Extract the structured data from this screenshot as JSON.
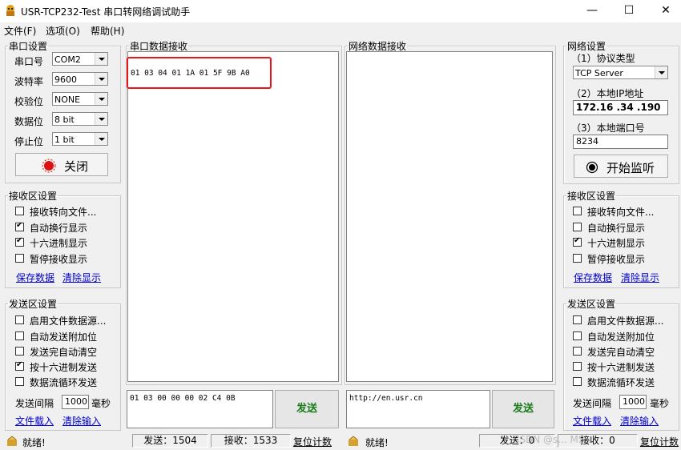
{
  "window": {
    "title": "USR-TCP232-Test 串口转网络调试助手",
    "minimize": "—",
    "maximize": "☐",
    "close": "✕"
  },
  "menu": {
    "file": "文件(F)",
    "options": "选项(O)",
    "help": "帮助(H)"
  },
  "serial_settings": {
    "legend": "串口设置",
    "port_label": "串口号",
    "port_value": "COM2",
    "baud_label": "波特率",
    "baud_value": "9600",
    "parity_label": "校验位",
    "parity_value": "NONE",
    "databits_label": "数据位",
    "databits_value": "8 bit",
    "stopbits_label": "停止位",
    "stopbits_value": "1 bit",
    "close_button": "关闭"
  },
  "left_receive_settings": {
    "legend": "接收区设置",
    "options": [
      {
        "label": "接收转向文件...",
        "checked": false
      },
      {
        "label": "自动换行显示",
        "checked": true
      },
      {
        "label": "十六进制显示",
        "checked": true
      },
      {
        "label": "暂停接收显示",
        "checked": false
      }
    ],
    "save_link": "保存数据",
    "clear_link": "清除显示"
  },
  "left_send_settings": {
    "legend": "发送区设置",
    "options": [
      {
        "label": "启用文件数据源...",
        "checked": false
      },
      {
        "label": "自动发送附加位",
        "checked": false
      },
      {
        "label": "发送完自动清空",
        "checked": false
      },
      {
        "label": "按十六进制发送",
        "checked": true
      },
      {
        "label": "数据流循环发送",
        "checked": false
      }
    ],
    "interval_label": "发送间隔",
    "interval_value": "1000",
    "interval_unit": "毫秒",
    "load_link": "文件载入",
    "clear_link": "清除输入"
  },
  "serial_receive": {
    "legend": "串口数据接收",
    "content": "01 03 04 01 1A 01 5F 9B A0",
    "highlight_color": "#e8151b"
  },
  "network_receive": {
    "legend": "网络数据接收",
    "content": ""
  },
  "serial_send": {
    "content": "01 03 00 00 00 02 C4 0B",
    "button": "发送"
  },
  "network_send": {
    "content": "http://en.usr.cn",
    "button": "发送"
  },
  "network_settings": {
    "legend": "网络设置",
    "protocol_label": "（1）协议类型",
    "protocol_value": "TCP Server",
    "ip_label": "（2）本地IP地址",
    "ip_value": "172.16 .34 .190",
    "port_label": "（3）本地端口号",
    "port_value": "8234",
    "listen_button": "开始监听"
  },
  "right_receive_settings": {
    "legend": "接收区设置",
    "options": [
      {
        "label": "接收转向文件...",
        "checked": false
      },
      {
        "label": "自动换行显示",
        "checked": false
      },
      {
        "label": "十六进制显示",
        "checked": true
      },
      {
        "label": "暂停接收显示",
        "checked": false
      }
    ],
    "save_link": "保存数据",
    "clear_link": "清除显示"
  },
  "right_send_settings": {
    "legend": "发送区设置",
    "options": [
      {
        "label": "启用文件数据源...",
        "checked": false
      },
      {
        "label": "自动发送附加位",
        "checked": false
      },
      {
        "label": "发送完自动清空",
        "checked": false
      },
      {
        "label": "按十六进制发送",
        "checked": false
      },
      {
        "label": "数据流循环发送",
        "checked": false
      }
    ],
    "interval_label": "发送间隔",
    "interval_value": "1000",
    "interval_unit": "毫秒",
    "load_link": "文件载入",
    "clear_link": "清除输入"
  },
  "status_left": {
    "ready": "就绪!",
    "sent": "发送：1504",
    "received": "接收：1533",
    "reset": "复位计数"
  },
  "status_right": {
    "ready": "就绪!",
    "sent": "发送：0",
    "received": "接收：0",
    "reset": "复位计数"
  },
  "watermark": "CSDN @s... MS..."
}
